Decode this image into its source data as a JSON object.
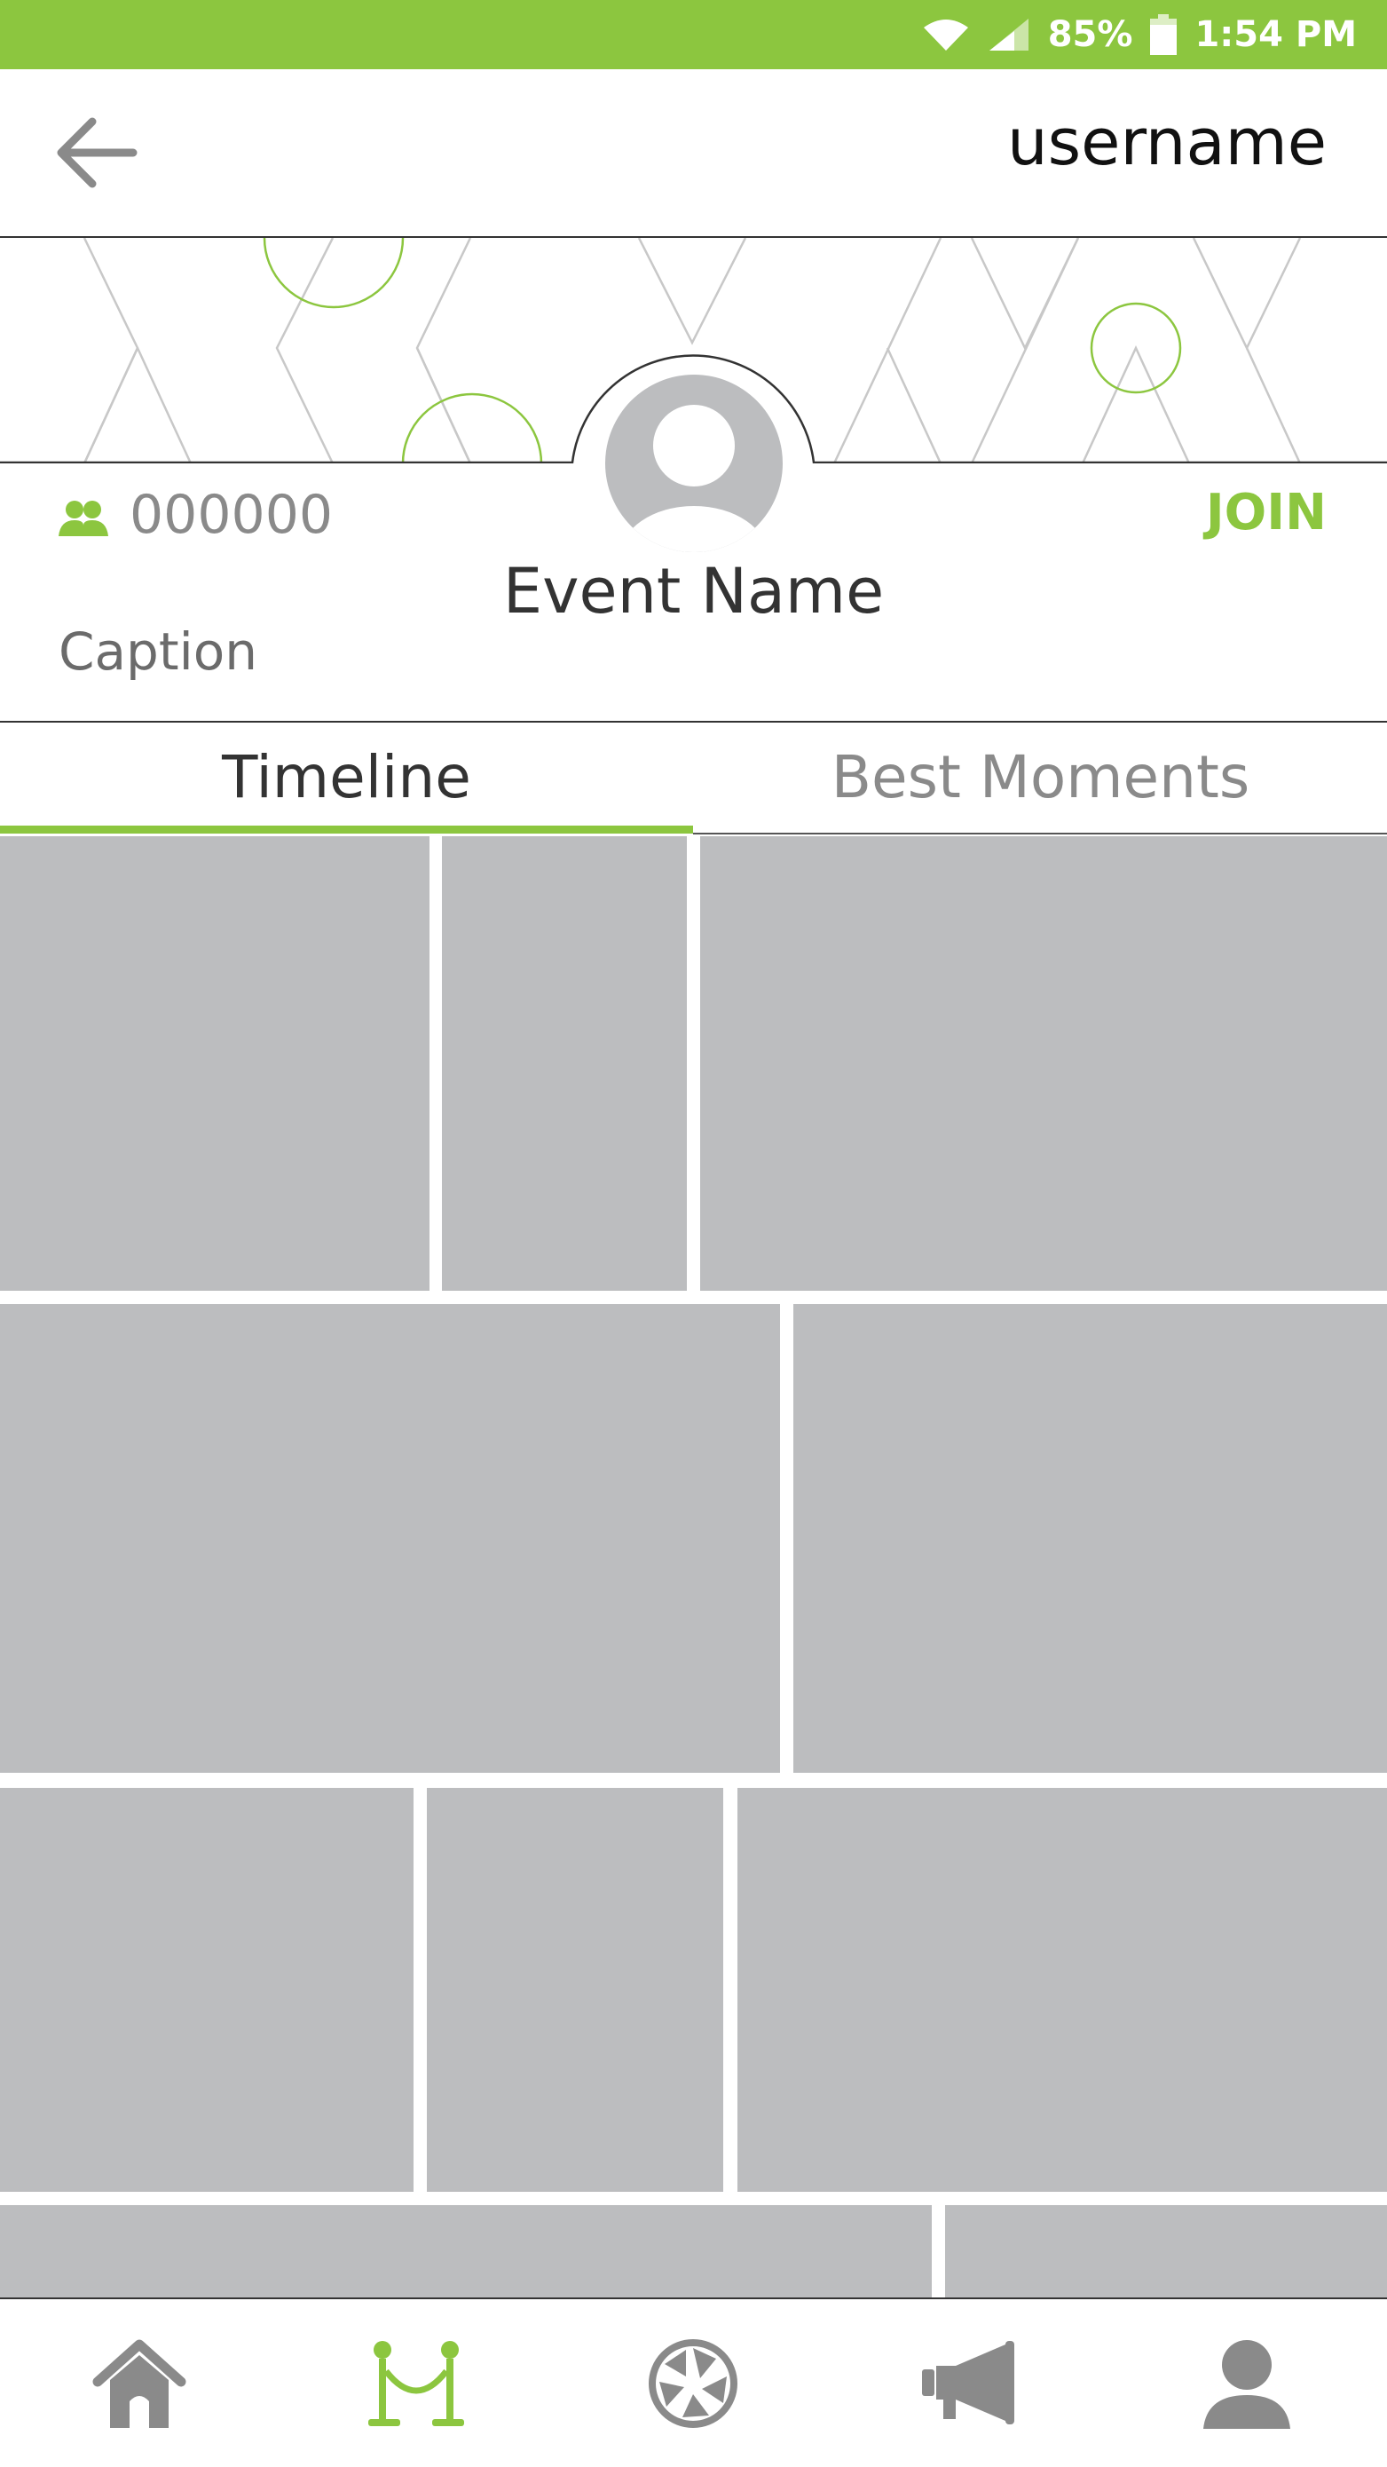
{
  "status_bar": {
    "battery": "85%",
    "time": "1:54 PM",
    "icons": [
      "wifi-icon",
      "cell-signal-icon",
      "battery-icon"
    ],
    "color": "#8cc63f"
  },
  "header": {
    "back_icon": "arrow-left-icon",
    "username": "username"
  },
  "event": {
    "member_count": "000000",
    "join_label": "JOIN",
    "name": "Event Name",
    "caption": "Caption",
    "avatar_icon": "person-avatar-icon"
  },
  "tabs": [
    {
      "label": "Timeline",
      "active": true
    },
    {
      "label": "Best Moments",
      "active": false
    }
  ],
  "bottom_nav": [
    {
      "icon": "home-icon",
      "active": false
    },
    {
      "icon": "event-stanchion-icon",
      "active": true
    },
    {
      "icon": "camera-aperture-icon",
      "active": false
    },
    {
      "icon": "megaphone-icon",
      "active": false
    },
    {
      "icon": "profile-icon",
      "active": false
    }
  ],
  "colors": {
    "accent": "#8cc63f",
    "tile": "#bcbdbf",
    "icon_gray": "#8a8a8a"
  }
}
